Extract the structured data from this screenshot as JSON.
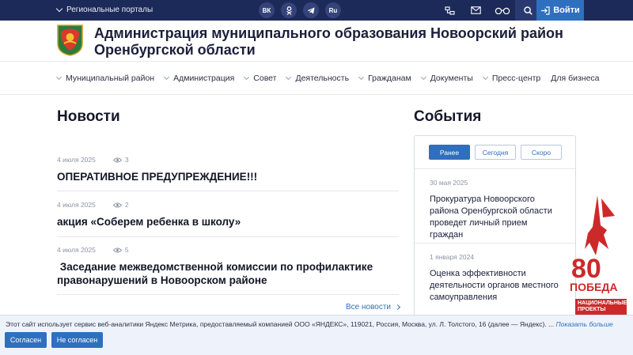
{
  "topbar": {
    "portals_label": "Региональные порталы",
    "social": [
      "ВК",
      "ОК",
      "TG",
      "Ru"
    ],
    "login_label": "Войти"
  },
  "header": {
    "title": "Администрация муниципального образования Новоорский район Оренбургской области"
  },
  "nav": {
    "items": [
      "Муниципальный район",
      "Администрация",
      "Совет",
      "Деятельность",
      "Гражданам",
      "Документы",
      "Пресс-центр",
      "Для бизнеса"
    ]
  },
  "news": {
    "heading": "Новости",
    "items": [
      {
        "date": "4 июля 2025",
        "views": "3",
        "title": "ОПЕРАТИВНОЕ ПРЕДУПРЕЖДЕНИЕ!!!"
      },
      {
        "date": "4 июля 2025",
        "views": "2",
        "title": "акция «Соберем ребенка в школу»"
      },
      {
        "date": "4 июля 2025",
        "views": "5",
        "title": " Заседание межведомственной комиссии по профилактике правонарушений в Новоорском районе"
      }
    ],
    "all_link": "Все новости"
  },
  "events": {
    "heading": "События",
    "tabs": [
      "Ранее",
      "Сегодня",
      "Скоро"
    ],
    "active_tab": "Ранее",
    "items": [
      {
        "date": "30 мая 2025",
        "title": "Прокуратура Новоорского района Оренбургской области проведет личный прием граждан"
      },
      {
        "date": "1 января 2024",
        "title": "Оценка эффективности деятельности органов местного самоуправления"
      }
    ]
  },
  "badge": {
    "number": "80",
    "text": "ПОБЕДА!",
    "nat_projects": "НАЦИОНАЛЬНЫЕ ПРОЕКТЫ"
  },
  "cookie": {
    "text": "Этот сайт использует сервис веб-аналитики Яндекс Метрика, предоставляемый компанией ООО «ЯНДЕКС», 119021, Россия, Москва, ул. Л. Толстого, 16 (далее — Яндекс). ...",
    "more": "Показать больше",
    "accept": "Согласен",
    "decline": "Не согласен"
  },
  "colors": {
    "topbar": "#1c2a5a",
    "accent": "#2f6fbf",
    "badge_red": "#cc2a2a"
  }
}
